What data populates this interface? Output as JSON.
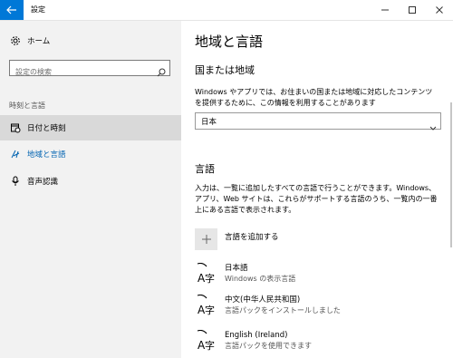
{
  "window": {
    "title": "設定"
  },
  "sidebar": {
    "home_label": "ホーム",
    "search_placeholder": "設定の検索",
    "section_label": "時刻と言語",
    "items": [
      {
        "label": "日付と時刻",
        "icon": "date-time-icon"
      },
      {
        "label": "地域と言語",
        "icon": "region-language-icon"
      },
      {
        "label": "音声認識",
        "icon": "microphone-icon"
      }
    ]
  },
  "main": {
    "title": "地域と言語",
    "region": {
      "heading": "国または地域",
      "description": "Windows やアプリでは、お住まいの国または地域に対応したコンテンツを提供するために、この情報を利用することがあります",
      "selected": "日本"
    },
    "language": {
      "heading": "言語",
      "description": "入力は、一覧に追加したすべての言語で行うことができます。Windows、アプリ、Web サイトは、これらがサポートする言語のうち、一覧内の一番上にある言語で表示されます。",
      "add_label": "言語を追加する",
      "items": [
        {
          "name": "日本語",
          "status": "Windows の表示言語"
        },
        {
          "name": "中文(中华人民共和国)",
          "status": "言語パックをインストールしました"
        },
        {
          "name": "English (Ireland)",
          "status": "言語パックを使用できます"
        }
      ]
    }
  },
  "colors": {
    "accent": "#0078d7",
    "active_text": "#0063b1",
    "sidebar_bg": "#f2f2f2",
    "selected_bg": "#d9d9d9"
  }
}
